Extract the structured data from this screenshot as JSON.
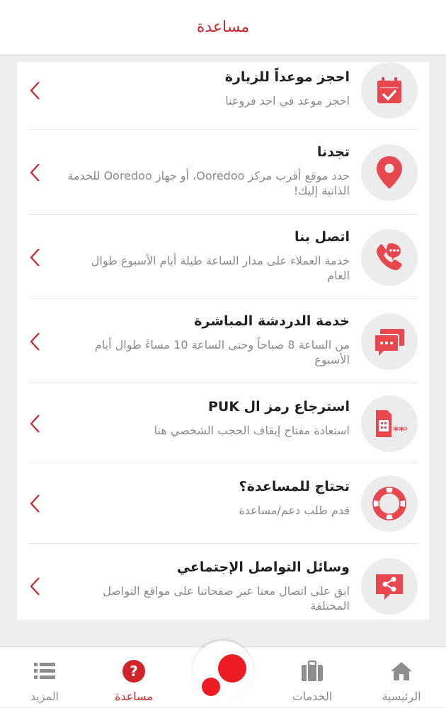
{
  "header": {
    "title": "مساعدة"
  },
  "colors": {
    "accent": "#d2232a",
    "icon_red": "#e8474f",
    "icon_bg": "#ececec"
  },
  "items": [
    {
      "title": "احجز موعداً للزيارة",
      "desc": "احجز موعد في احد فروعنا",
      "icon": "calendar-check-icon"
    },
    {
      "title": "تجدنا",
      "desc": "حدد موقع أقرب مركز Ooredoo، أو جهاز Ooredoo للخدمة الذاتية إليك!",
      "icon": "location-pin-icon"
    },
    {
      "title": "اتصل بنا",
      "desc": "خدمة العملاء على مدار الساعة طيلة أيام الأسبوع طوال العام",
      "icon": "phone-chat-icon"
    },
    {
      "title": "خدمة الدردشة المباشرة",
      "desc": "من الساعة 8 صباحاً وحتى الساعة 10 مساءً طوال أيام الأسبوع",
      "icon": "chat-bubbles-icon"
    },
    {
      "title": "استرجاع رمز ال PUK",
      "desc": "استعادة مفتاح إيقاف الحجب الشخصي هنا",
      "icon": "sim-card-icon"
    },
    {
      "title": "تحتاج للمساعدة؟",
      "desc": "قدم طلب دعم/مساعدة",
      "icon": "lifebuoy-icon"
    },
    {
      "title": "وسائل التواصل الإجتماعي",
      "desc": "ابق على اتصال معنا عبر صفحاتنا على مواقع التواصل المختلفة",
      "icon": "share-icon"
    }
  ],
  "nav": {
    "home": "الرئيسية",
    "services": "الخدمات",
    "help": "مساعدة",
    "more": "المزيد"
  }
}
